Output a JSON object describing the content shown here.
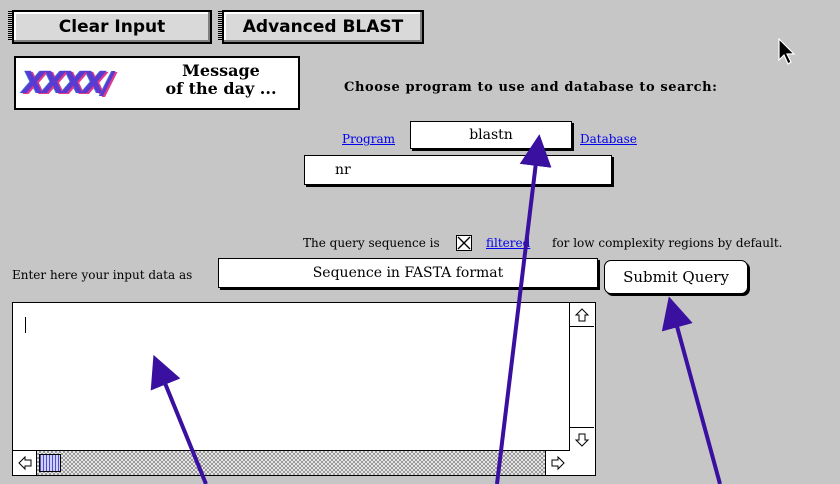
{
  "toolbar": {
    "clear_label": "Clear Input",
    "advanced_label": "Advanced BLAST"
  },
  "motd": {
    "logo_text": "XXXX/",
    "line1": "Message",
    "line2": "of the day ..."
  },
  "form": {
    "heading": "Choose program to use and database to search:",
    "program_link": "Program",
    "program_value": "blastn",
    "database_link": "Database",
    "database_value": "nr",
    "filter_prefix": "The query sequence is",
    "filter_checked": true,
    "filter_link": "filtered",
    "filter_suffix": "for low complexity regions by default.",
    "input_label": "Enter here your input data as",
    "input_format": "Sequence in FASTA format",
    "submit_label": "Submit Query",
    "sequence_value": ""
  },
  "colors": {
    "background": "#c6c6c6",
    "link": "#0000ee",
    "annotation_arrow": "#3a10a0"
  },
  "icons": [
    "pointer-cursor-icon",
    "scroll-up-icon",
    "scroll-down-icon",
    "scroll-left-icon",
    "scroll-right-icon",
    "checkbox-x-icon"
  ]
}
